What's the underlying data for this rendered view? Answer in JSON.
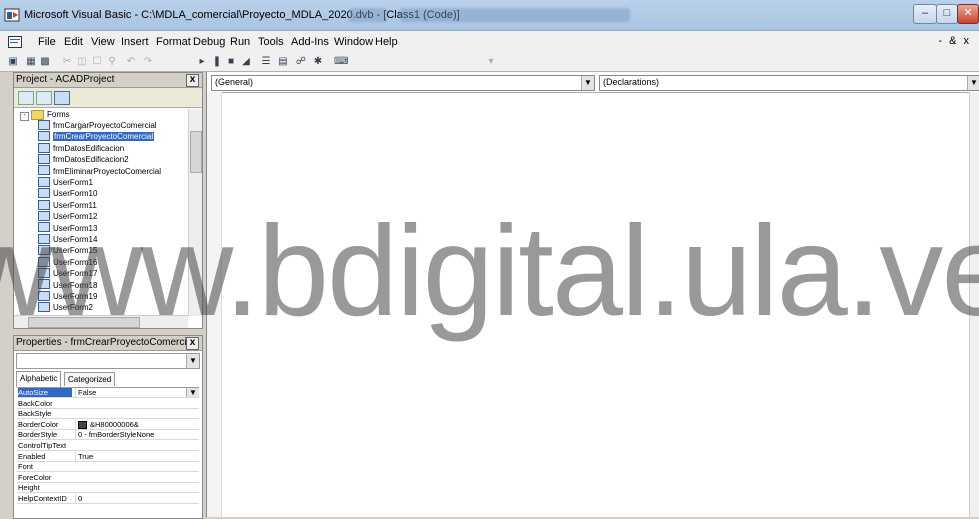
{
  "window": {
    "title": "Microsoft Visual Basic - C:\\MDLA_comercial\\Proyecto_MDLA_2020.dvb - [Class1 (Code)]",
    "controls": [
      "minimize-icon",
      "maximize-icon",
      "close-icon"
    ]
  },
  "menubar": {
    "items": [
      "File",
      "Edit",
      "View",
      "Insert",
      "Format",
      "Debug",
      "Run",
      "Tools",
      "Add-Ins",
      "Window",
      "Help"
    ],
    "mdi_controls": "- & x"
  },
  "toolbar": {
    "icons": [
      "view-icon",
      "insert-userform-icon",
      "save-icon",
      "cut-icon",
      "copy-icon",
      "paste-icon",
      "find-icon",
      "undo-icon",
      "redo-icon",
      "run-icon",
      "break-icon",
      "reset-icon",
      "design-mode-icon",
      "project-explorer-icon",
      "properties-icon",
      "object-browser-icon",
      "toolbox-icon",
      "help-icon"
    ]
  },
  "project": {
    "title": "Project - ACADProject",
    "folder": "Forms",
    "items": [
      {
        "label": "frmCargarProyectoComercial",
        "selected": false
      },
      {
        "label": "frmCrearProyectoComercial",
        "selected": true
      },
      {
        "label": "frmDatosEdificacion",
        "selected": false
      },
      {
        "label": "frmDatosEdificacion2",
        "selected": false
      },
      {
        "label": "frmEliminarProyectoComercial",
        "selected": false
      },
      {
        "label": "UserForm1",
        "selected": false
      },
      {
        "label": "UserForm10",
        "selected": false
      },
      {
        "label": "UserForm11",
        "selected": false
      },
      {
        "label": "UserForm12",
        "selected": false
      },
      {
        "label": "UserForm13",
        "selected": false
      },
      {
        "label": "UserForm14",
        "selected": false
      },
      {
        "label": "UserForm15",
        "selected": false
      },
      {
        "label": "UserForm16",
        "selected": false
      },
      {
        "label": "UserForm17",
        "selected": false
      },
      {
        "label": "UserForm18",
        "selected": false
      },
      {
        "label": "UserForm19",
        "selected": false
      },
      {
        "label": "UserForm2",
        "selected": false
      }
    ]
  },
  "properties": {
    "title": "Properties - frmCrearProyectoComercial",
    "tabs": [
      "Alphabetic",
      "Categorized"
    ],
    "active_tab": "Alphabetic",
    "rows": [
      {
        "name": "AutoSize",
        "value": "False",
        "selected": true,
        "swatch": false
      },
      {
        "name": "BackColor",
        "value": "",
        "selected": false,
        "swatch": false
      },
      {
        "name": "BackStyle",
        "value": "",
        "selected": false,
        "swatch": false
      },
      {
        "name": "BorderColor",
        "value": "&H80000006&",
        "selected": false,
        "swatch": true
      },
      {
        "name": "BorderStyle",
        "value": "0 - fmBorderStyleNone",
        "selected": false,
        "swatch": false
      },
      {
        "name": "ControlTipText",
        "value": "",
        "selected": false,
        "swatch": false
      },
      {
        "name": "Enabled",
        "value": "True",
        "selected": false,
        "swatch": false
      },
      {
        "name": "Font",
        "value": "",
        "selected": false,
        "swatch": false
      },
      {
        "name": "ForeColor",
        "value": "",
        "selected": false,
        "swatch": false
      },
      {
        "name": "Height",
        "value": "",
        "selected": false,
        "swatch": false
      },
      {
        "name": "HelpContextID",
        "value": "0",
        "selected": false,
        "swatch": false
      }
    ]
  },
  "code": {
    "object_combo": "(General)",
    "procedure_combo": "(Declarations)"
  },
  "watermark": "www.bdigital.ula.ve",
  "colors": {
    "selection": "#3168c5",
    "titlebar": "#b9d1ea",
    "chrome": "#d4d0c8"
  }
}
